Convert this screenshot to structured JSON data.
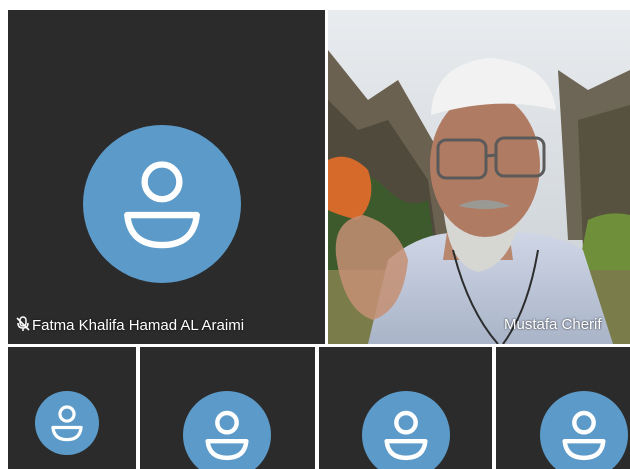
{
  "participants": [
    {
      "name": "Fatma Khalifa Hamad AL Araimi",
      "muted": true,
      "video": false,
      "icon": "person-icon"
    },
    {
      "name": "Mustafa Cherif",
      "muted": false,
      "video": true
    }
  ],
  "bottom_row_tiles": [
    {
      "icon": "person-icon"
    },
    {
      "icon": "person-icon"
    },
    {
      "icon": "person-icon"
    },
    {
      "icon": "person-icon"
    }
  ],
  "colors": {
    "tile_background": "#2b2b2b",
    "avatar_blue": "#5c9bc9",
    "label_text": "#ffffff"
  }
}
